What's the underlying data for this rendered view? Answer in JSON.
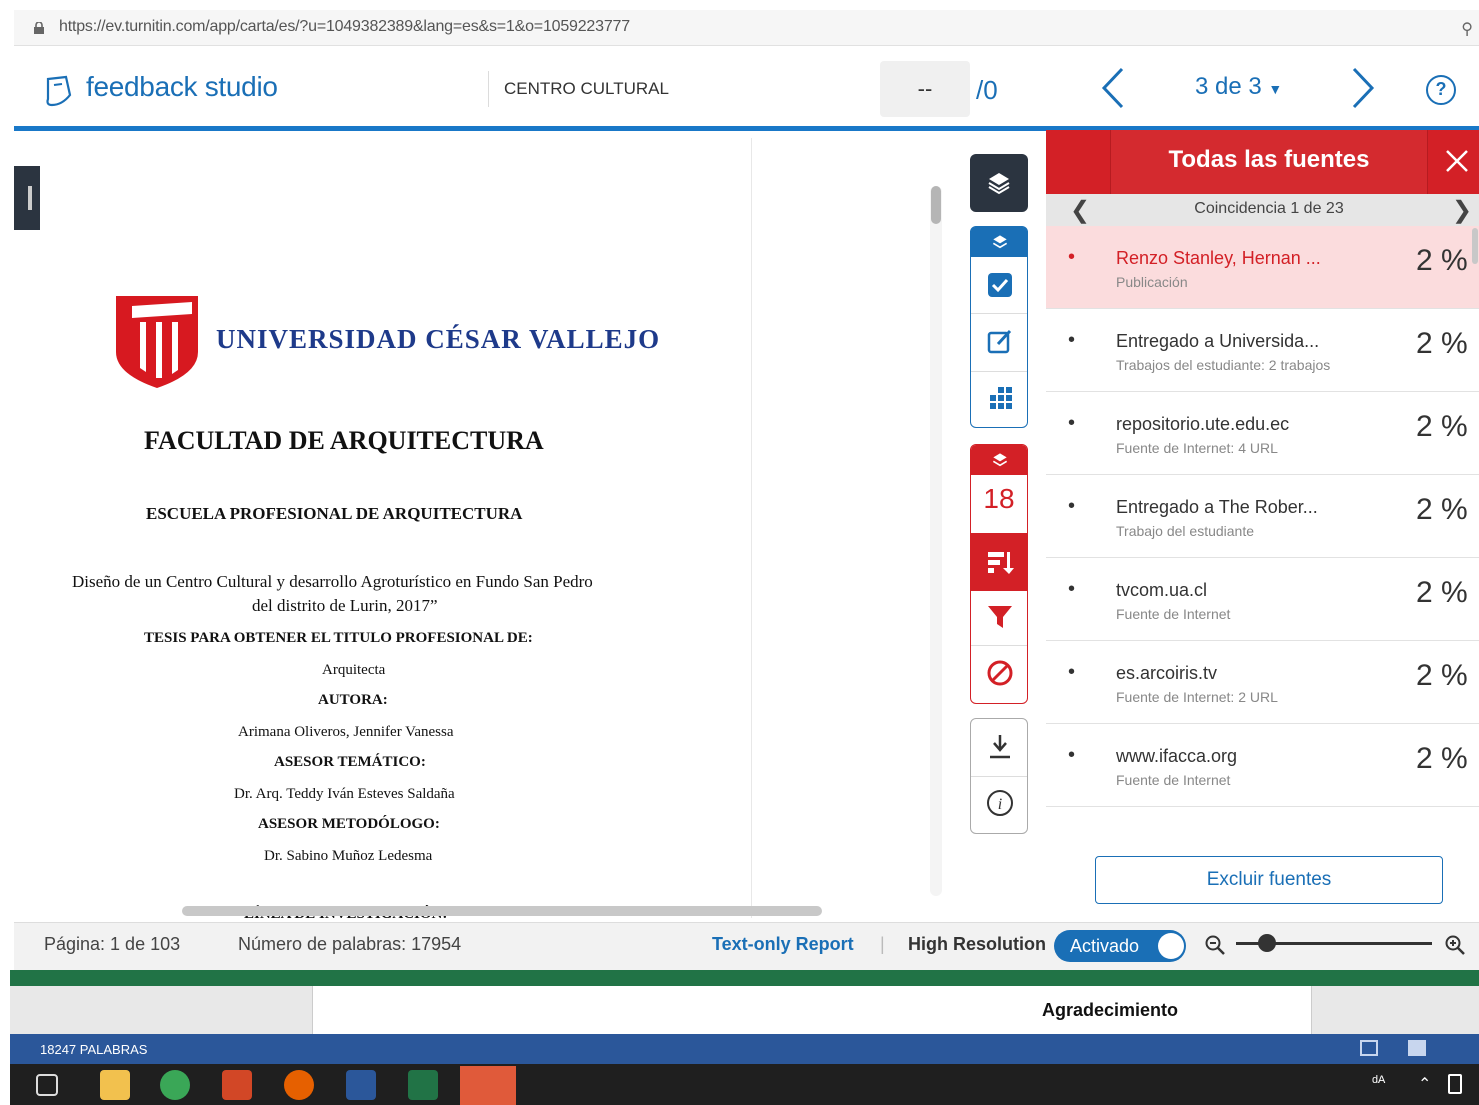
{
  "browser": {
    "url": "https://ev.turnitin.com/app/carta/es/?u=1049382389&lang=es&s=1&o=1059223777"
  },
  "header": {
    "logo_text": "feedback studio",
    "assignment_title": "CENTRO CULTURAL",
    "page_input_value": "--",
    "page_total": "/0",
    "doc_counter": "3 de 3"
  },
  "document": {
    "university": "UNIVERSIDAD CÉSAR VALLEJO",
    "faculty": "FACULTAD DE ARQUITECTURA",
    "school": "ESCUELA PROFESIONAL DE ARQUITECTURA",
    "title_line1": "Diseño de un Centro Cultural y desarrollo Agroturístico en Fundo San Pedro",
    "title_line2": "del distrito de Lurin, 2017”",
    "thesis_label": "TESIS PARA OBTENER EL TITULO PROFESIONAL DE:",
    "degree": "Arquitecta",
    "author_label": "AUTORA:",
    "author": "Arimana Oliveros, Jennifer Vanessa",
    "advisor_label": "ASESOR TEMÁTICO:",
    "advisor": "Dr. Arq. Teddy Iván Esteves Saldaña",
    "method_label": "ASESOR METODÓLOGO:",
    "method_advisor": "Dr. Sabino Muñoz Ledesma",
    "research_line": "LÍNEA DE INVESTIGACIÓN:"
  },
  "tools": {
    "match_count": "18"
  },
  "panel": {
    "title": "Todas las fuentes",
    "match_nav": "Coincidencia 1 de 23",
    "sources": [
      {
        "name": "Renzo Stanley, Hernan ...",
        "type": "Publicación",
        "pct": "2 %",
        "active": true
      },
      {
        "name": "Entregado a Universida...",
        "type": "Trabajos del estudiante: 2 trabajos",
        "pct": "2 %"
      },
      {
        "name": "repositorio.ute.edu.ec",
        "type": "Fuente de Internet: 4 URL",
        "pct": "2 %"
      },
      {
        "name": "Entregado a The Rober...",
        "type": "Trabajo del estudiante",
        "pct": "2 %"
      },
      {
        "name": "tvcom.ua.cl",
        "type": "Fuente de Internet",
        "pct": "2 %"
      },
      {
        "name": "es.arcoiris.tv",
        "type": "Fuente de Internet: 2 URL",
        "pct": "2 %"
      },
      {
        "name": "www.ifacca.org",
        "type": "Fuente de Internet",
        "pct": "2 %"
      }
    ],
    "exclude_button": "Excluir fuentes"
  },
  "statusbar": {
    "page": "Página: 1 de 103",
    "words": "Número de palabras: 17954",
    "text_only": "Text-only Report",
    "separator": "|",
    "high_res": "High Resolution",
    "toggle": "Activado"
  },
  "word_app": {
    "heading": "Agradecimiento",
    "word_count": "18247 PALABRAS"
  },
  "colors": {
    "turnitin_blue": "#1a6fb6",
    "match_red": "#d32026",
    "word_blue": "#2b579a",
    "excel_green": "#217346"
  }
}
